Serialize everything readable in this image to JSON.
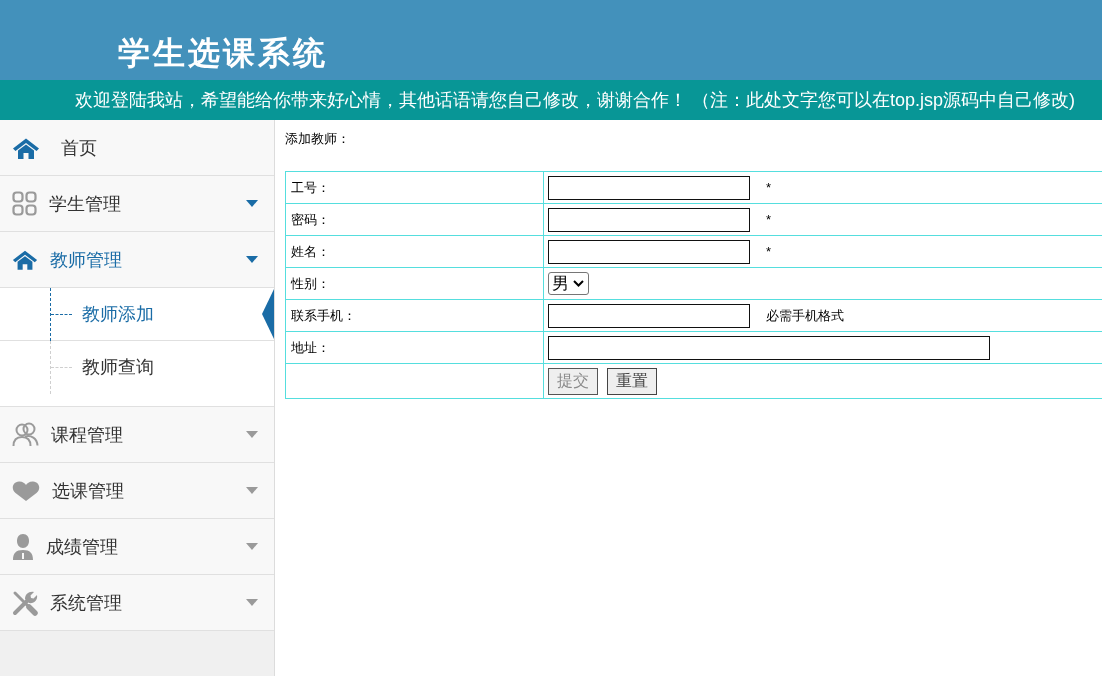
{
  "header": {
    "title": "学生选课系统"
  },
  "notice": {
    "text": "欢迎登陆我站，希望能给你带来好心情，其他话语请您自己修改，谢谢合作！ （注：此处文字您可以在top.jsp源码中自己修改)"
  },
  "sidebar": {
    "items": [
      {
        "kind": "link",
        "label": "首页"
      },
      {
        "kind": "group",
        "label": "学生管理",
        "expanded": false,
        "highlighted": true
      },
      {
        "kind": "group",
        "label": "教师管理",
        "expanded": true,
        "highlighted": true,
        "children": [
          {
            "label": "教师添加",
            "selected": true
          },
          {
            "label": "教师查询",
            "selected": false
          }
        ]
      },
      {
        "kind": "group",
        "label": "课程管理",
        "expanded": false,
        "highlighted": false
      },
      {
        "kind": "group",
        "label": "选课管理",
        "expanded": false,
        "highlighted": false
      },
      {
        "kind": "group",
        "label": "成绩管理",
        "expanded": false,
        "highlighted": false
      },
      {
        "kind": "group",
        "label": "系统管理",
        "expanded": false,
        "highlighted": false
      }
    ]
  },
  "content": {
    "heading": "添加教师：",
    "form": {
      "rows": [
        {
          "kind": "text",
          "label": "工号：",
          "note": "*"
        },
        {
          "kind": "text",
          "label": "密码：",
          "note": "*"
        },
        {
          "kind": "text",
          "label": "姓名：",
          "note": "*"
        },
        {
          "kind": "select",
          "label": "性别：",
          "value": "男"
        },
        {
          "kind": "text",
          "label": "联系手机：",
          "note": "必需手机格式"
        },
        {
          "kind": "wide_text",
          "label": "地址："
        }
      ],
      "buttons": [
        {
          "label": "提交",
          "disabled": true
        },
        {
          "label": "重置",
          "disabled": false
        }
      ]
    }
  }
}
